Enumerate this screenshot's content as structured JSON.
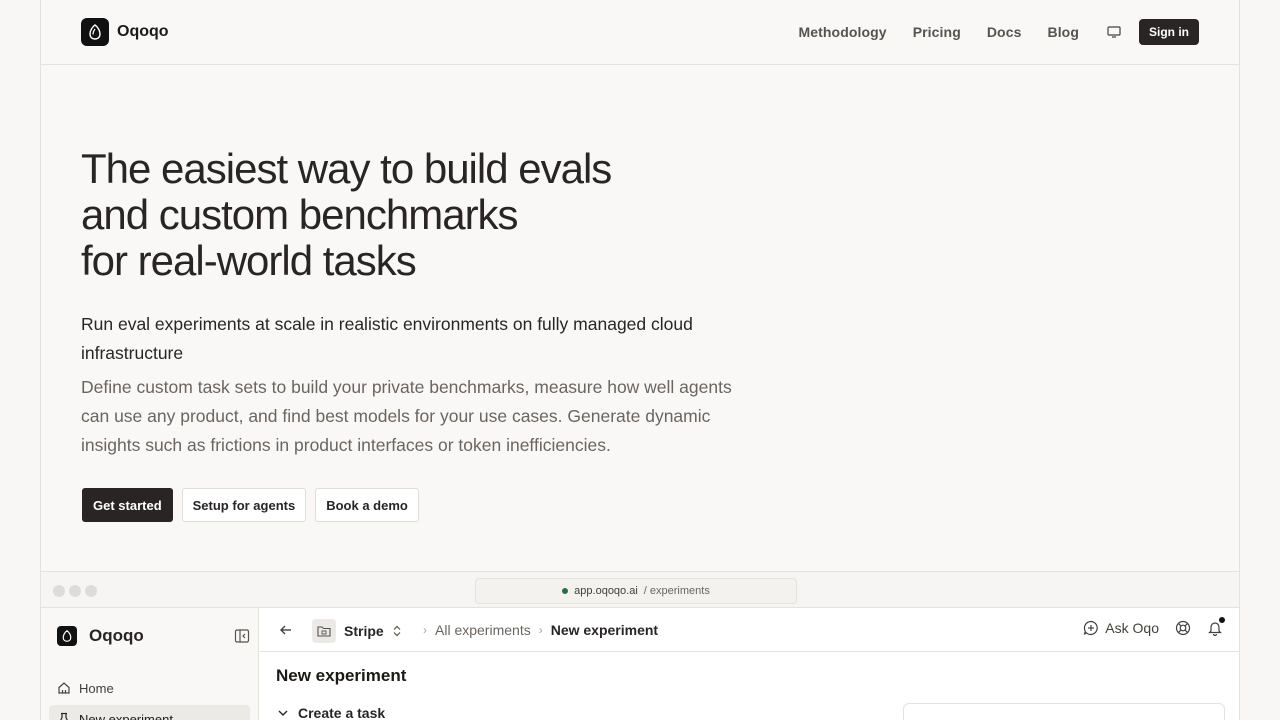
{
  "nav": {
    "brand": "Oqoqo",
    "links": [
      "Methodology",
      "Pricing",
      "Docs",
      "Blog"
    ],
    "signin": "Sign in"
  },
  "hero": {
    "title_lines": [
      "The easiest way to build evals",
      "and custom benchmarks",
      "for real-world tasks"
    ],
    "subtitle": "Run eval experiments at scale in realistic environments on fully managed cloud infrastructure",
    "description": "Define custom task sets to build your private benchmarks, measure how well agents can use any product, and find best models for your use cases. Generate dynamic insights such as frictions in product interfaces or token inefficiencies.",
    "buttons": {
      "get_started": "Get started",
      "setup_agents": "Setup for agents",
      "book_demo": "Book a demo"
    }
  },
  "preview": {
    "url_host": "app.oqoqo.ai",
    "url_path": "/ experiments",
    "sidebar": {
      "brand": "Oqoqo",
      "items": [
        {
          "label": "Home",
          "icon": "home-icon"
        },
        {
          "label": "New experiment",
          "icon": "flask-icon"
        }
      ]
    },
    "toolbar": {
      "project": "Stripe",
      "crumbs": [
        "All experiments",
        "New experiment"
      ],
      "ask": "Ask Oqo"
    },
    "content": {
      "title": "New experiment",
      "section": "Create a task"
    }
  },
  "colors": {
    "background": "#f8f7f5",
    "primary": "#292524",
    "status_green": "#2f6b47"
  }
}
